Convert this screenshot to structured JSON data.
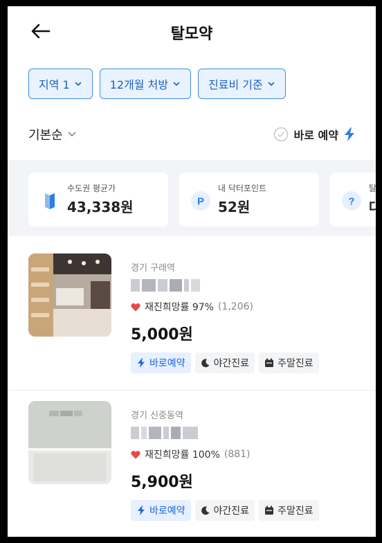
{
  "header": {
    "title": "탈모약"
  },
  "filters": [
    {
      "label": "지역 1"
    },
    {
      "label": "12개월 처방"
    },
    {
      "label": "진료비 기준"
    }
  ],
  "sort": {
    "label": "기본순",
    "instant_label": "바로 예약"
  },
  "stats": [
    {
      "label": "수도권 평균가",
      "value": "43,338원",
      "icon": "map-icon"
    },
    {
      "label": "내 닥터포인트",
      "value": "52원",
      "icon": "point-icon"
    },
    {
      "label": "탈",
      "value": "대",
      "icon": "question-icon"
    }
  ],
  "listings": [
    {
      "location": "경기 구래역",
      "rating_text": "재진희망률 97%",
      "rating_count": "(1,206)",
      "price": "5,000원",
      "tags": [
        "바로예약",
        "야간진료",
        "주말진료"
      ]
    },
    {
      "location": "경기 신중동역",
      "rating_text": "재진희망률 100%",
      "rating_count": "(881)",
      "price": "5,900원",
      "tags": [
        "바로예약",
        "야간진료",
        "주말진료"
      ]
    }
  ],
  "colors": {
    "accent": "#2f7de1",
    "heart": "#e5484d"
  }
}
